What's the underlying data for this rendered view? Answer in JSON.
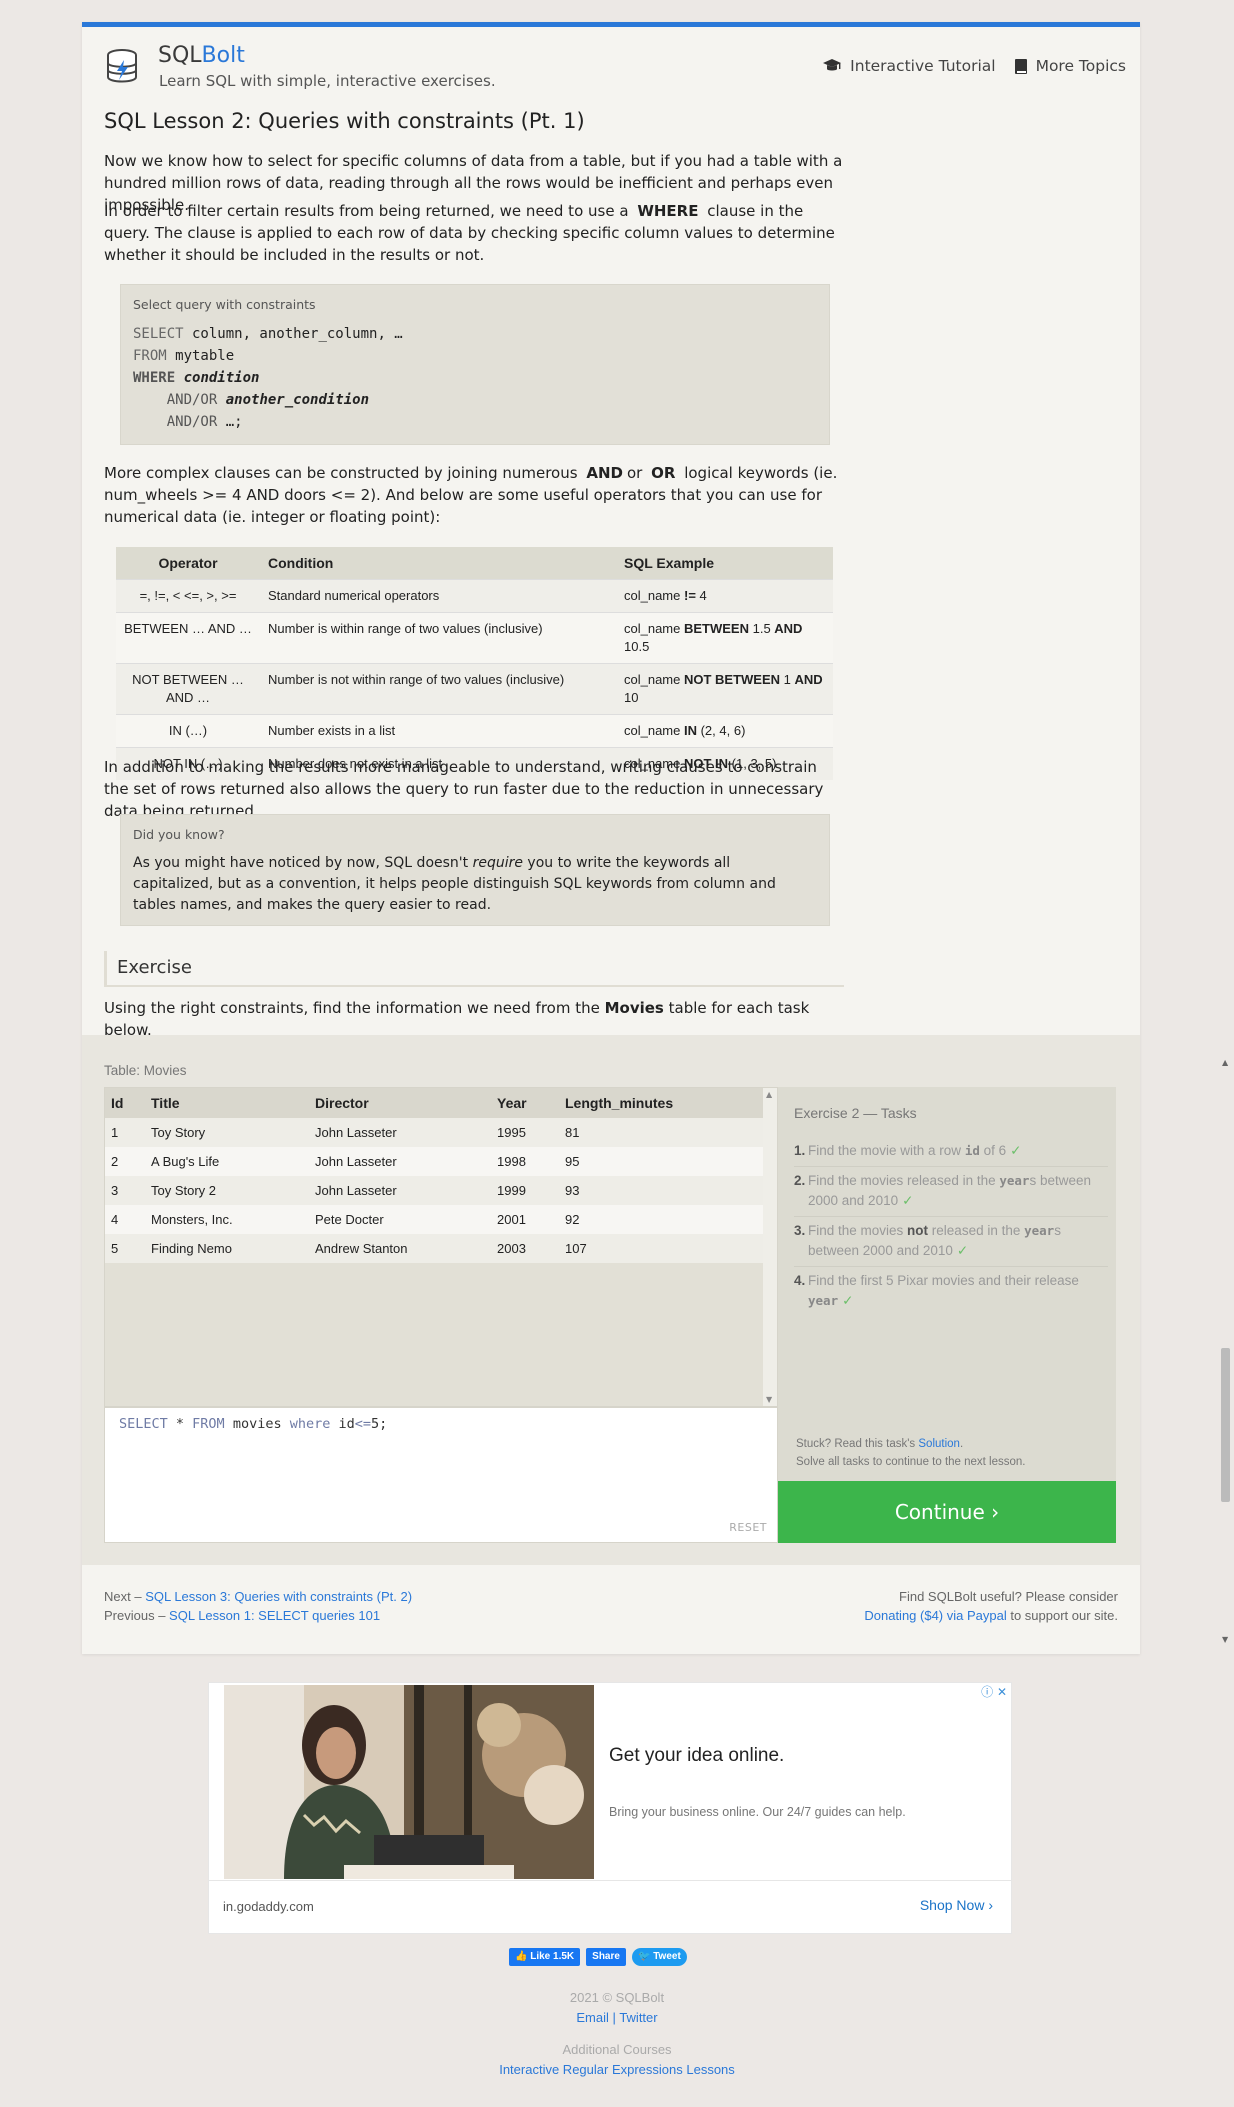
{
  "header": {
    "brand_part1": "SQL",
    "brand_part2": "Bolt",
    "tagline": "Learn SQL with simple, interactive exercises.",
    "nav": [
      {
        "label": "Interactive Tutorial",
        "icon": "graduation-cap-icon"
      },
      {
        "label": "More Topics",
        "icon": "book-icon"
      }
    ]
  },
  "lesson": {
    "title": "SQL Lesson 2: Queries with constraints (Pt. 1)",
    "intro": "Now we know how to select for specific columns of data from a table, but if you had a table with a hundred million rows of data, reading through all the rows would be inefficient and perhaps even impossible.",
    "where_before": "In order to filter certain results from being returned, we need to use a",
    "where_kw": "WHERE",
    "where_after": "clause in the query. The clause is applied to each row of data by checking specific column values to determine whether it should be included in the results or not.",
    "code_caption": "Select query with constraints",
    "code_line1_kw": "SELECT",
    "code_line1_rest": " column, another_column, …",
    "code_line2_kw": "FROM",
    "code_line2_rest": " mytable",
    "code_line3_kw": "WHERE",
    "code_line3_rest": " condition",
    "code_line4_kw": "AND/OR",
    "code_line4_rest": " another_condition",
    "code_line5_kw": "AND/OR",
    "code_line5_rest": " …;",
    "complex_a": "More complex clauses can be constructed by joining numerous",
    "complex_and": "AND",
    "complex_or_word": "or",
    "complex_or": "OR",
    "complex_b": "logical keywords (ie. num_wheels >= 4 AND doors <= 2). And below are some useful operators that you can use for numerical data (ie. integer or floating point):",
    "operators_headers": [
      "Operator",
      "Condition",
      "SQL Example"
    ],
    "operators": [
      {
        "op": "=, !=, < <=, >, >=",
        "cond": "Standard numerical operators",
        "ex_pre": "col_name ",
        "ex_b1": "!=",
        "ex_mid": " 4",
        "ex_b2": "",
        "ex_post": ""
      },
      {
        "op": "BETWEEN … AND …",
        "cond": "Number is within range of two values (inclusive)",
        "ex_pre": "col_name ",
        "ex_b1": "BETWEEN",
        "ex_mid": " 1.5 ",
        "ex_b2": "AND",
        "ex_post": " 10.5"
      },
      {
        "op": "NOT BETWEEN … AND …",
        "cond": "Number is not within range of two values (inclusive)",
        "ex_pre": "col_name ",
        "ex_b1": "NOT BETWEEN",
        "ex_mid": " 1 ",
        "ex_b2": "AND",
        "ex_post": " 10"
      },
      {
        "op": "IN (…)",
        "cond": "Number exists in a list",
        "ex_pre": "col_name ",
        "ex_b1": "IN",
        "ex_mid": " (2, 4, 6)",
        "ex_b2": "",
        "ex_post": ""
      },
      {
        "op": "NOT IN (…)",
        "cond": "Number does not exist in a list",
        "ex_pre": "col_name ",
        "ex_b1": "NOT IN",
        "ex_mid": " (1, 3, 5)",
        "ex_b2": "",
        "ex_post": ""
      }
    ],
    "addition": "In addition to making the results more manageable to understand, writing clauses to constrain the set of rows returned also allows the query to run faster due to the reduction in unnecessary data being returned.",
    "did_caption": "Did you know?",
    "did_a": "As you might have noticed by now, SQL doesn't ",
    "did_em": "require",
    "did_b": " you to write the keywords all capitalized, but as a convention, it helps people distinguish SQL keywords from column and tables names, and makes the query easier to read.",
    "exercise_title": "Exercise",
    "exercise_a": "Using the right constraints, find the information we need from the ",
    "exercise_b": "Movies",
    "exercise_c": " table for each task below."
  },
  "exercise": {
    "table_caption": "Table: Movies",
    "columns": [
      "Id",
      "Title",
      "Director",
      "Year",
      "Length_minutes"
    ],
    "rows": [
      [
        "1",
        "Toy Story",
        "John Lasseter",
        "1995",
        "81"
      ],
      [
        "2",
        "A Bug's Life",
        "John Lasseter",
        "1998",
        "95"
      ],
      [
        "3",
        "Toy Story 2",
        "John Lasseter",
        "1999",
        "93"
      ],
      [
        "4",
        "Monsters, Inc.",
        "Pete Docter",
        "2001",
        "92"
      ],
      [
        "5",
        "Finding Nemo",
        "Andrew Stanton",
        "2003",
        "107"
      ]
    ],
    "query_kw1": "SELECT",
    "query_mid1": " * ",
    "query_kw2": "FROM",
    "query_mid2": " movies ",
    "query_kw3": "where",
    "query_mid3": " id",
    "query_op": "<=",
    "query_end": "5;",
    "reset": "RESET",
    "tasks_title": "Exercise 2 — Tasks",
    "task1_a": "Find the movie with a row ",
    "task1_code": "id",
    "task1_b": " of 6",
    "task2_a": "Find the movies released in the ",
    "task2_code": "year",
    "task2_b": "s between 2000 and 2010",
    "task3_a": "Find the movies ",
    "task3_bold": "not",
    "task3_b": " released in the ",
    "task3_code": "year",
    "task3_c": "s between 2000 and 2010",
    "task4_a": "Find the first 5 Pixar movies and their release ",
    "task4_code": "year",
    "check": "✓",
    "stuck_a": "Stuck? Read this task's ",
    "stuck_link": "Solution",
    "stuck_b": ".",
    "stuck_line2": "Solve all tasks to continue to the next lesson.",
    "continue": "Continue ›"
  },
  "footer_nav": {
    "next_label": "Next – ",
    "next_link": "SQL Lesson 3: Queries with constraints (Pt. 2)",
    "prev_label": "Previous – ",
    "prev_link": "SQL Lesson 1: SELECT queries 101",
    "useful": "Find SQLBolt useful? Please consider",
    "donate_link": "Donating ($4) via Paypal",
    "support": " to support our site."
  },
  "ad": {
    "headline": "Get your idea online.",
    "sub": "Bring your business online. Our 24/7 guides can help.",
    "domain": "in.godaddy.com",
    "cta": "Shop Now",
    "adchoice": "ⓘ ✕"
  },
  "social": {
    "like": "Like 1.5K",
    "share": "Share",
    "tweet": "Tweet"
  },
  "site_footer": {
    "copyright": "2021 © SQLBolt",
    "email": "Email",
    "sep": "|",
    "twitter": "Twitter",
    "additional": "Additional Courses",
    "regex": "Interactive Regular Expressions Lessons"
  },
  "colors": {
    "accent": "#2a78d8",
    "continue": "#3cb54b",
    "page_bg": "#ece8e5",
    "card_bg": "#f5f4f0"
  }
}
